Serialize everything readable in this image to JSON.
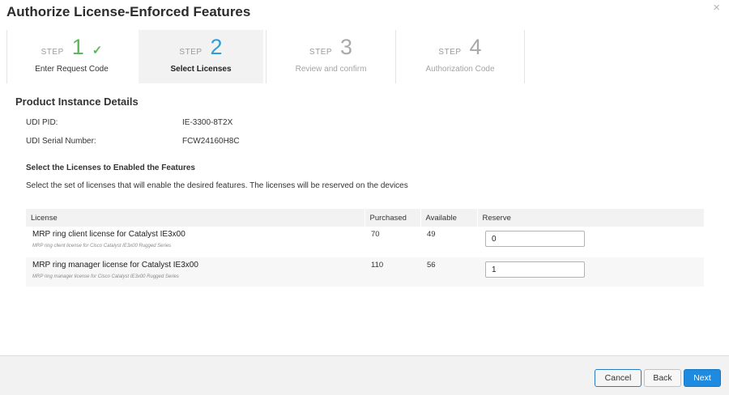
{
  "dialog": {
    "title": "Authorize License-Enforced Features",
    "close_glyph": "×"
  },
  "steps": [
    {
      "word": "STEP",
      "number": "1",
      "label": "Enter Request Code",
      "state": "done",
      "check_icon": "check-icon"
    },
    {
      "word": "STEP",
      "number": "2",
      "label": "Select Licenses",
      "state": "active"
    },
    {
      "word": "STEP",
      "number": "3",
      "label": "Review and confirm",
      "state": "future"
    },
    {
      "word": "STEP",
      "number": "4",
      "label": "Authorization Code",
      "state": "future"
    }
  ],
  "product": {
    "section_title": "Product Instance Details",
    "udi_pid_label": "UDI PID:",
    "udi_pid_value": "IE-3300-8T2X",
    "udi_serial_label": "UDI Serial Number:",
    "udi_serial_value": "FCW24160H8C"
  },
  "licenses": {
    "heading": "Select the Licenses to Enabled the Features",
    "description": "Select the set of licenses that will enable the desired features. The licenses will be reserved on the devices",
    "columns": {
      "license": "License",
      "purchased": "Purchased",
      "available": "Available",
      "reserve": "Reserve"
    },
    "rows": [
      {
        "name": "MRP ring client license for Catalyst IE3x00",
        "description": "MRP ring client license for Cisco Catalyst IE3x00 Rugged Series",
        "purchased": "70",
        "available": "49",
        "reserve": "0"
      },
      {
        "name": "MRP ring manager license for Catalyst IE3x00",
        "description": "MRP ring manager license for Cisco Catalyst IE3x00 Rugged Series",
        "purchased": "110",
        "available": "56",
        "reserve": "1"
      }
    ]
  },
  "footer": {
    "cancel_label": "Cancel",
    "back_label": "Back",
    "next_label": "Next"
  },
  "colors": {
    "step_done": "#5cb85c",
    "step_active": "#2b9fd8",
    "primary_button": "#1e8be0"
  }
}
